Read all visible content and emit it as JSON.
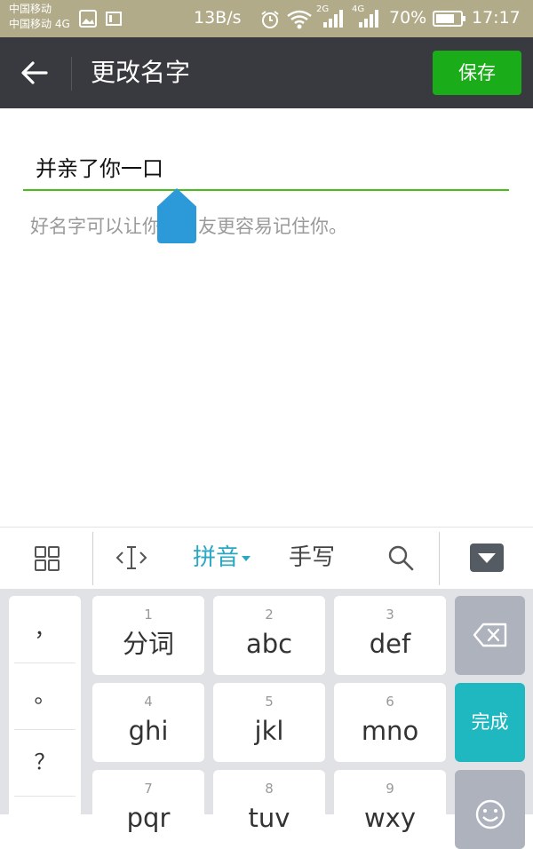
{
  "status_bar": {
    "carrier_1": "中国移动",
    "carrier_2": "中国移动 4G",
    "net_speed": "13B/s",
    "network_2g": "2G",
    "network_4g": "4G",
    "battery": "70%",
    "time": "17:17"
  },
  "header": {
    "title": "更改名字",
    "save_label": "保存"
  },
  "form": {
    "name_value": "并亲了你一口",
    "hint": "好名字可以让你的朋友更容易记住你。"
  },
  "ime_toolbar": {
    "mode_pinyin": "拼音",
    "mode_handwrite": "手写"
  },
  "keyboard": {
    "punct": [
      "，",
      "。",
      "？"
    ],
    "keys": [
      {
        "num": "1",
        "label": "分词"
      },
      {
        "num": "2",
        "label": "abc"
      },
      {
        "num": "3",
        "label": "def"
      },
      {
        "num": "4",
        "label": "ghi"
      },
      {
        "num": "5",
        "label": "jkl"
      },
      {
        "num": "6",
        "label": "mno"
      },
      {
        "num": "7",
        "label": "pqr"
      },
      {
        "num": "8",
        "label": "tuv"
      },
      {
        "num": "9",
        "label": "wxy"
      }
    ],
    "done_label": "完成"
  },
  "colors": {
    "status_bar_bg": "#b2ab8a",
    "title_bar_bg": "#393a3f",
    "save_button_bg": "#1aad19",
    "input_underline": "#45c01a",
    "ime_accent": "#29a8c2",
    "done_key_bg": "#1fb7c0"
  },
  "icons": [
    "back-arrow-icon",
    "gallery-icon",
    "sim-icon",
    "alarm-icon",
    "wifi-icon",
    "signal-icon",
    "battery-icon",
    "grid-icon",
    "cursor-move-icon",
    "search-icon",
    "keyboard-hide-icon",
    "backspace-icon",
    "emoji-icon",
    "cursor-handle-icon"
  ]
}
